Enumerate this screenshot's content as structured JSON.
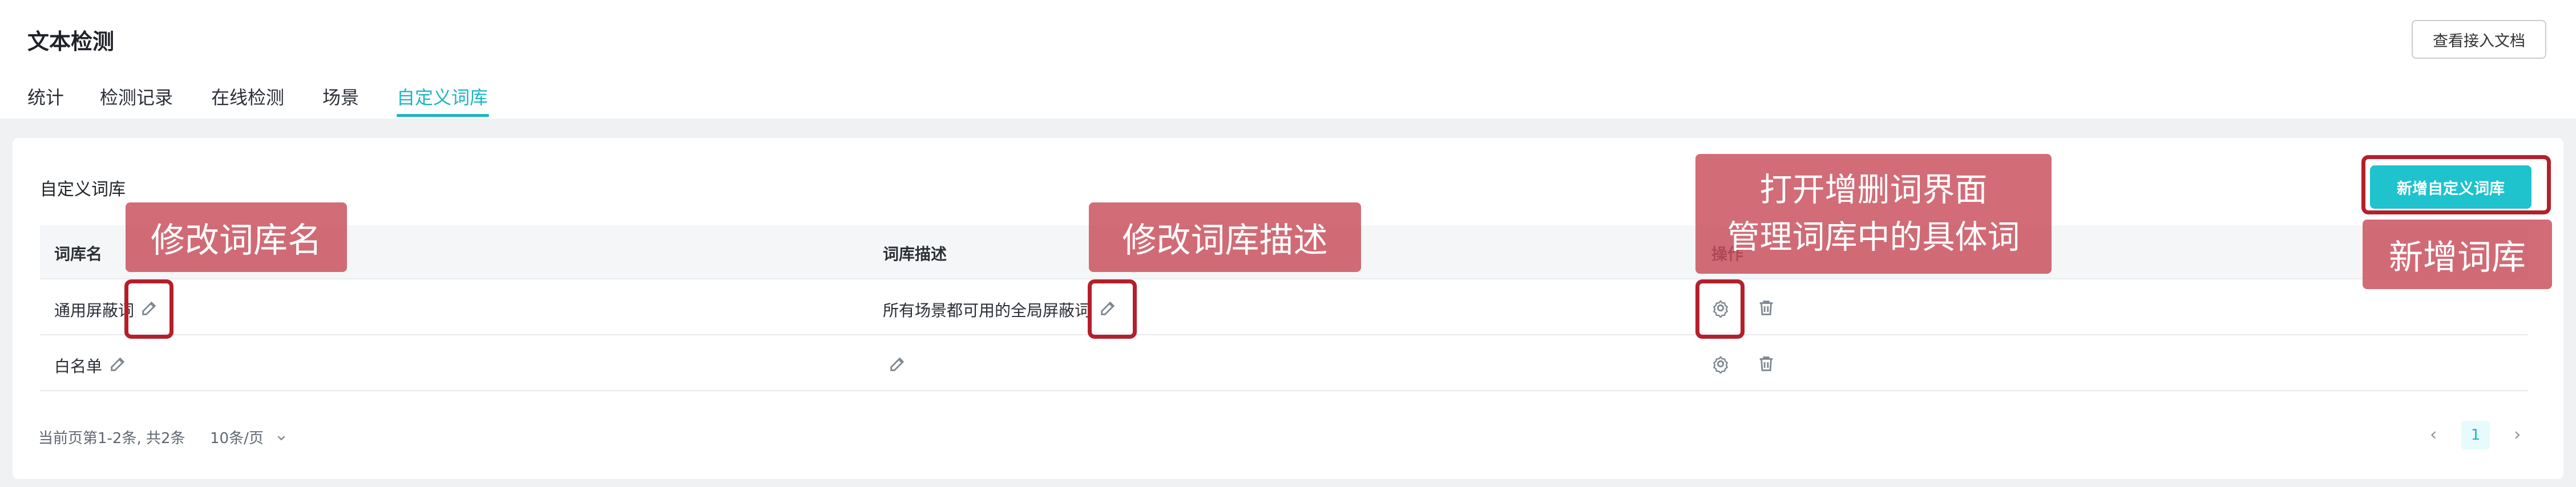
{
  "header": {
    "title": "文本检测",
    "doc_button": "查看接入文档",
    "tabs": [
      {
        "label": "统计"
      },
      {
        "label": "检测记录"
      },
      {
        "label": "在线检测"
      },
      {
        "label": "场景"
      },
      {
        "label": "自定义词库",
        "active": true
      }
    ]
  },
  "section": {
    "title": "自定义词库",
    "add_button": "新增自定义词库"
  },
  "table": {
    "columns": [
      "词库名",
      "词库描述",
      "操作"
    ],
    "rows": [
      {
        "name": "通用屏蔽词",
        "description": "所有场景都可用的全局屏蔽词"
      },
      {
        "name": "白名单",
        "description": ""
      }
    ]
  },
  "pagination": {
    "summary": "当前页第1-2条, 共2条",
    "page_size": "10条/页",
    "current_page": "1"
  },
  "annotations": {
    "edit_name": "修改词库名",
    "edit_desc": "修改词库描述",
    "open_manage_line1": "打开增删词界面",
    "open_manage_line2": "管理词库中的具体词",
    "new_library": "新增词库"
  },
  "colors": {
    "accent": "#1ab6c3",
    "primary_button": "#1ec3cd",
    "annotation_fill": "#c94e5b",
    "annotation_outline": "#b51f2b",
    "page_background": "#f0f1f2"
  },
  "icons": {
    "edit": "edit-icon",
    "settings": "gear-icon",
    "delete": "trash-icon",
    "chevron": "chevron-down-icon"
  }
}
